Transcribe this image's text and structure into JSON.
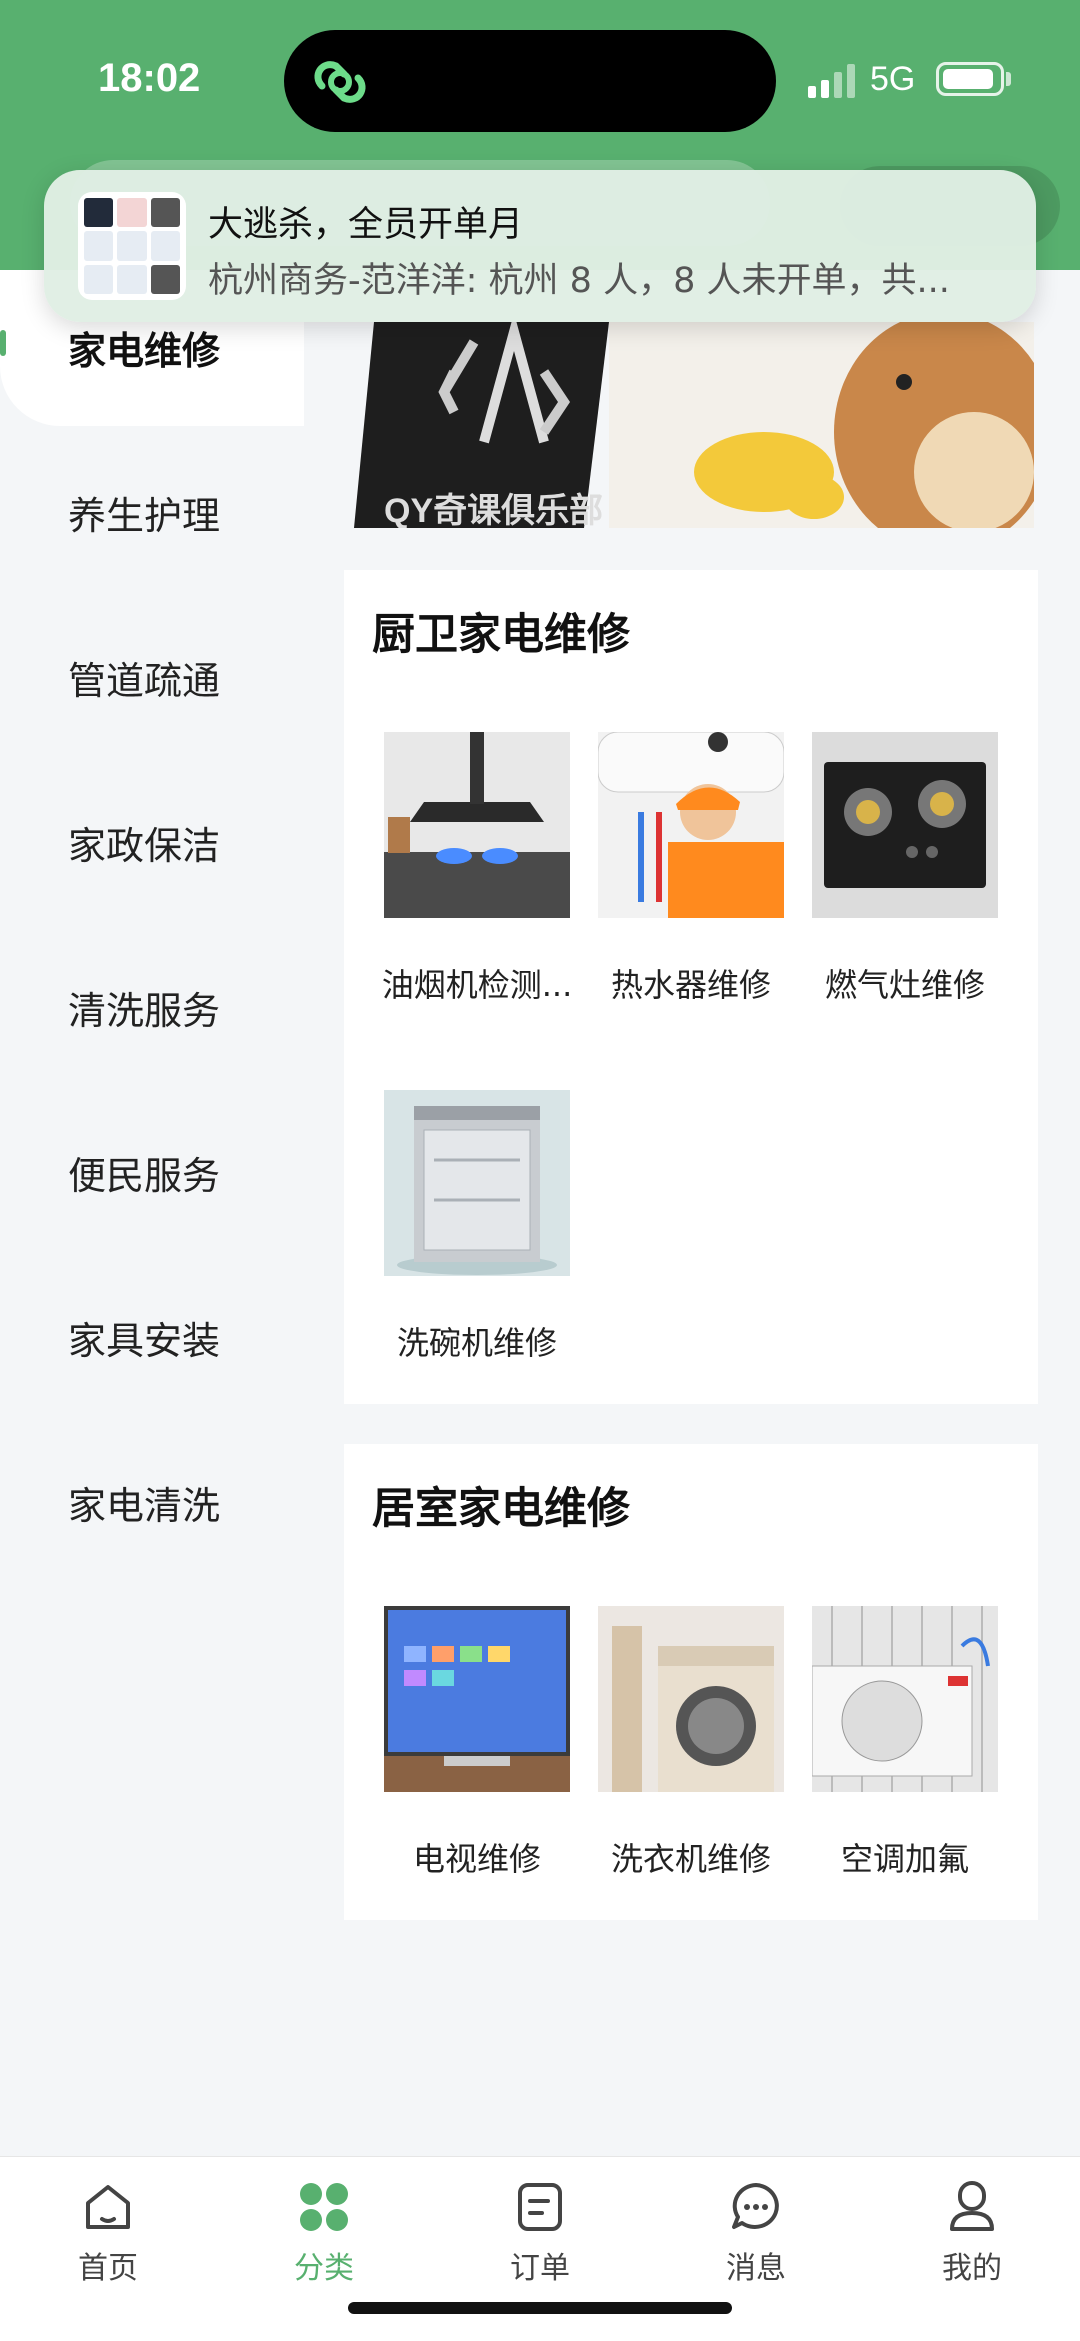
{
  "status_bar": {
    "time": "18:02",
    "network": "5G"
  },
  "notification": {
    "title": "大逃杀，全员开单月",
    "body": "杭州商务-范洋洋: 杭州 8 人，8 人未开单，共..."
  },
  "sidebar": {
    "items": [
      {
        "label": "家电维修",
        "active": true
      },
      {
        "label": "养生护理"
      },
      {
        "label": "管道疏通"
      },
      {
        "label": "家政保洁"
      },
      {
        "label": "清洗服务"
      },
      {
        "label": "便民服务"
      },
      {
        "label": "家具安装"
      },
      {
        "label": "家电清洗"
      }
    ]
  },
  "banner": {
    "logo_text": "QY奇课俱乐部"
  },
  "sections": [
    {
      "title": "厨卫家电维修",
      "items": [
        {
          "label": "油烟机检测...",
          "icon": "range-hood-image"
        },
        {
          "label": "热水器维修",
          "icon": "water-heater-image"
        },
        {
          "label": "燃气灶维修",
          "icon": "gas-stove-image"
        },
        {
          "label": "洗碗机维修",
          "icon": "dishwasher-image"
        }
      ]
    },
    {
      "title": "居室家电维修",
      "items": [
        {
          "label": "电视维修",
          "icon": "tv-image"
        },
        {
          "label": "洗衣机维修",
          "icon": "washing-machine-image"
        },
        {
          "label": "空调加氟",
          "icon": "air-conditioner-image"
        }
      ]
    }
  ],
  "tabbar": {
    "tabs": [
      {
        "label": "首页",
        "icon": "home-icon"
      },
      {
        "label": "分类",
        "icon": "category-icon",
        "active": true
      },
      {
        "label": "订单",
        "icon": "order-icon"
      },
      {
        "label": "消息",
        "icon": "message-icon"
      },
      {
        "label": "我的",
        "icon": "profile-icon"
      }
    ]
  },
  "colors": {
    "brand_green": "#58b06f",
    "background": "#f4f6f8"
  }
}
